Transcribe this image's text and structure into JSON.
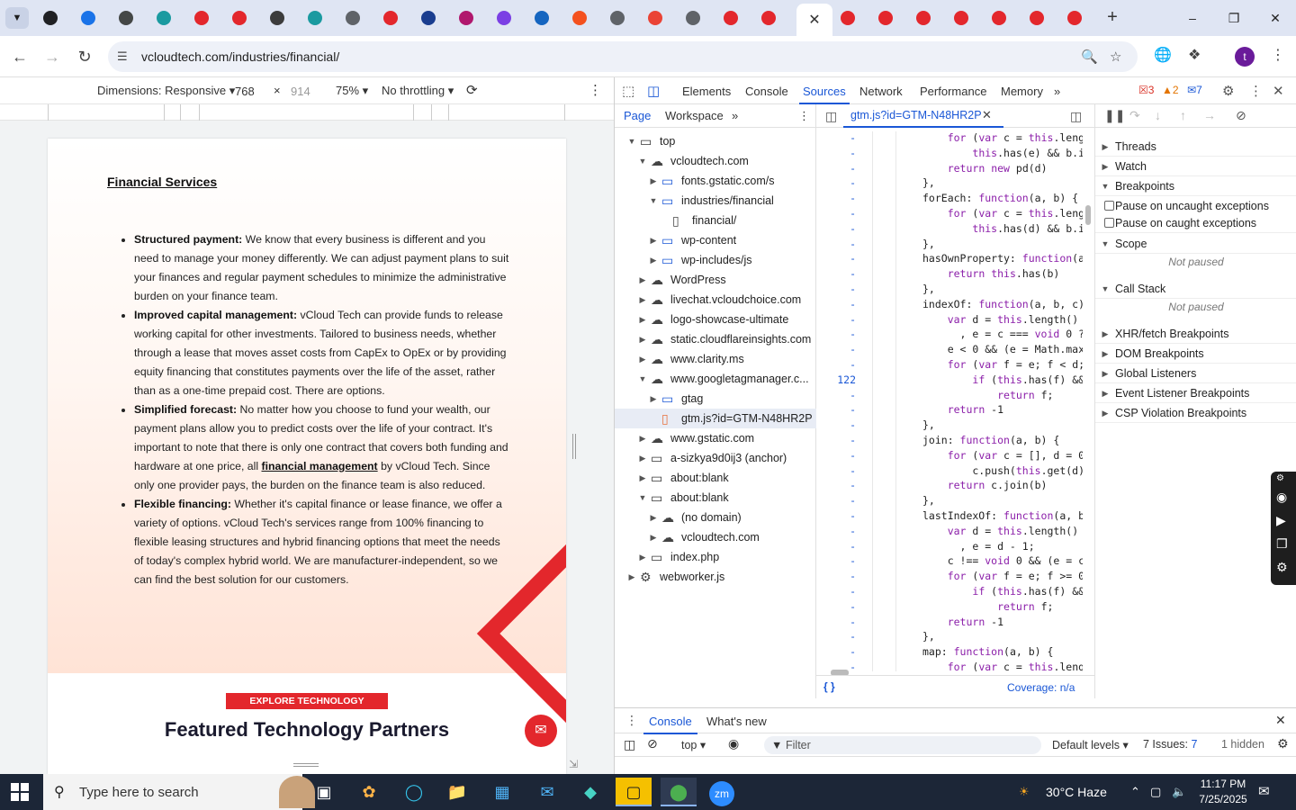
{
  "browser": {
    "tab_search_icon": "chevron-down",
    "tabs": [
      {
        "name": "tab-1",
        "color": "#202124"
      },
      {
        "name": "tab-2",
        "color": "#1a73e8"
      },
      {
        "name": "tab-3",
        "color": "#444746"
      },
      {
        "name": "tab-4",
        "color": "#1a9aa0"
      },
      {
        "name": "tab-5",
        "color": "#e3272c"
      },
      {
        "name": "tab-6",
        "color": "#e3272c"
      },
      {
        "name": "tab-7",
        "color": "#3c3c3c"
      },
      {
        "name": "tab-8",
        "color": "#1a9aa0"
      },
      {
        "name": "tab-9",
        "color": "#5f6368"
      },
      {
        "name": "tab-10",
        "color": "#e3272c"
      },
      {
        "name": "tab-11",
        "color": "#1a3d8f"
      },
      {
        "name": "tab-12",
        "color": "#b0176d"
      },
      {
        "name": "tab-13",
        "color": "#7b3fe4"
      },
      {
        "name": "tab-14",
        "color": "#1565c0"
      },
      {
        "name": "tab-15",
        "color": "#f4511e"
      },
      {
        "name": "tab-16",
        "color": "#5f6368"
      },
      {
        "name": "tab-17",
        "color": "#ea4335"
      },
      {
        "name": "tab-18",
        "color": "#5f6368"
      },
      {
        "name": "tab-19",
        "color": "#e3272c"
      },
      {
        "name": "tab-20",
        "color": "#e3272c"
      }
    ],
    "active_tab_close": "✕",
    "tabs_after": [
      {
        "name": "tab-22",
        "color": "#e3272c"
      },
      {
        "name": "tab-23",
        "color": "#e3272c"
      },
      {
        "name": "tab-24",
        "color": "#e3272c"
      },
      {
        "name": "tab-25",
        "color": "#e3272c"
      },
      {
        "name": "tab-26",
        "color": "#e3272c"
      },
      {
        "name": "tab-27",
        "color": "#e3272c"
      },
      {
        "name": "tab-28",
        "color": "#e3272c"
      }
    ],
    "new_tab": "+",
    "url": "vcloudtech.com/industries/financial/",
    "profile_initial": "t"
  },
  "device_toolbar": {
    "dimensions_label": "Dimensions: Responsive",
    "width": "768",
    "times": "×",
    "height_placeholder": "914",
    "zoom": "75%",
    "throttling": "No throttling"
  },
  "site": {
    "title": "Financial Services",
    "bullets": [
      {
        "head": "Structured payment:",
        "text": " We know that every business is different and you need to manage your money differently. We can adjust payment plans to suit your finances and regular payment schedules to minimize the administrative burden on your finance team."
      },
      {
        "head": "Improved capital management:",
        "text": " vCloud Tech can provide funds to release working capital for other investments. Tailored to business needs, whether through a lease that moves asset costs from CapEx to OpEx or by providing equity financing that constitutes payments over the life of the asset, rather than as a one-time prepaid cost. There are options."
      },
      {
        "head": "Simplified forecast:",
        "text": " No matter how you choose to fund your wealth, our payment plans allow you to predict costs over the life of your contract. It's important to note that there is only one contract that covers both funding and hardware at one price, all ",
        "link": "financial management",
        "tail": " by vCloud Tech. Since only one provider pays, the burden on the finance team is also reduced."
      },
      {
        "head": "Flexible financing:",
        "text": " Whether it's capital finance or lease finance, we offer a variety of options. vCloud Tech's services range from 100% financing to flexible leasing structures and hybrid financing options that meet the needs of today's complex hybrid world. We are manufacturer-independent, so we can find the best solution for our customers."
      }
    ],
    "explore_button": "EXPLORE TECHNOLOGY PARTNERS",
    "featured_heading": "Featured Technology Partners"
  },
  "devtools": {
    "tabs": [
      "Elements",
      "Console",
      "Sources",
      "Network",
      "Performance",
      "Memory"
    ],
    "active_tab": "Sources",
    "more_tabs": "»",
    "errors": "3",
    "warnings": "2",
    "messages": "7",
    "navigator_tabs": [
      "Page",
      "Workspace"
    ],
    "active_navigator_tab": "Page",
    "tree": [
      {
        "label": "top",
        "depth": 0,
        "icon": "frame",
        "open": true
      },
      {
        "label": "vcloudtech.com",
        "depth": 1,
        "icon": "cloud",
        "open": true
      },
      {
        "label": "fonts.gstatic.com/s",
        "depth": 2,
        "icon": "folder",
        "open": false
      },
      {
        "label": "industries/financial",
        "depth": 2,
        "icon": "folder",
        "open": true
      },
      {
        "label": "financial/",
        "depth": 3,
        "icon": "file",
        "open": null
      },
      {
        "label": "wp-content",
        "depth": 2,
        "icon": "folder",
        "open": false
      },
      {
        "label": "wp-includes/js",
        "depth": 2,
        "icon": "folder",
        "open": false
      },
      {
        "label": "WordPress",
        "depth": 1,
        "icon": "cloud",
        "open": false
      },
      {
        "label": "livechat.vcloudchoice.com",
        "depth": 1,
        "icon": "cloud",
        "open": false
      },
      {
        "label": "logo-showcase-ultimate",
        "depth": 1,
        "icon": "cloud",
        "open": false
      },
      {
        "label": "static.cloudflareinsights.com",
        "depth": 1,
        "icon": "cloud",
        "open": false
      },
      {
        "label": "www.clarity.ms",
        "depth": 1,
        "icon": "cloud",
        "open": false
      },
      {
        "label": "www.googletagmanager.c...",
        "depth": 1,
        "icon": "cloud",
        "open": true
      },
      {
        "label": "gtag",
        "depth": 2,
        "icon": "folder",
        "open": false
      },
      {
        "label": "gtm.js?id=GTM-N48HR2P",
        "depth": 2,
        "icon": "js-file",
        "open": null,
        "selected": true
      },
      {
        "label": "www.gstatic.com",
        "depth": 1,
        "icon": "cloud",
        "open": false
      },
      {
        "label": "a-sizkya9d0ij3 (anchor)",
        "depth": 1,
        "icon": "frame",
        "open": false
      },
      {
        "label": "about:blank",
        "depth": 1,
        "icon": "frame",
        "open": false
      },
      {
        "label": "about:blank",
        "depth": 1,
        "icon": "frame",
        "open": true
      },
      {
        "label": "(no domain)",
        "depth": 2,
        "icon": "cloud",
        "open": false
      },
      {
        "label": "vcloudtech.com",
        "depth": 2,
        "icon": "cloud",
        "open": false
      },
      {
        "label": "index.php",
        "depth": 1,
        "icon": "frame",
        "open": false
      },
      {
        "label": "webworker.js",
        "depth": 0,
        "icon": "gear",
        "open": false
      }
    ],
    "open_file": "gtm.js?id=GTM-N48HR2P",
    "code_lines": [
      {
        "n": "-",
        "code": "    for (var c = this.lengt"
      },
      {
        "n": "-",
        "code": "        this.has(e) && b.ir"
      },
      {
        "n": "-",
        "code": "    return new pd(d)"
      },
      {
        "n": "-",
        "code": "},"
      },
      {
        "n": "-",
        "code": "forEach: function(a, b) {"
      },
      {
        "n": "-",
        "code": "    for (var c = this.lengt"
      },
      {
        "n": "-",
        "code": "        this.has(d) && b.ir"
      },
      {
        "n": "-",
        "code": "},"
      },
      {
        "n": "-",
        "code": "hasOwnProperty: function(a,"
      },
      {
        "n": "-",
        "code": "    return this.has(b)"
      },
      {
        "n": "-",
        "code": "},"
      },
      {
        "n": "-",
        "code": "indexOf: function(a, b, c)"
      },
      {
        "n": "-",
        "code": "    var d = this.length()"
      },
      {
        "n": "-",
        "code": "      , e = c === void 0 ?"
      },
      {
        "n": "-",
        "code": "    e < 0 && (e = Math.max("
      },
      {
        "n": "-",
        "code": "    for (var f = e; f < d;"
      },
      {
        "n": "122",
        "code": "        if (this.has(f) &&"
      },
      {
        "n": "-",
        "code": "            return f;"
      },
      {
        "n": "-",
        "code": "    return -1"
      },
      {
        "n": "-",
        "code": "},"
      },
      {
        "n": "-",
        "code": "join: function(a, b) {"
      },
      {
        "n": "-",
        "code": "    for (var c = [], d = 0;"
      },
      {
        "n": "-",
        "code": "        c.push(this.get(d))"
      },
      {
        "n": "-",
        "code": "    return c.join(b)"
      },
      {
        "n": "-",
        "code": "},"
      },
      {
        "n": "-",
        "code": "lastIndexOf: function(a, b,"
      },
      {
        "n": "-",
        "code": "    var d = this.length()"
      },
      {
        "n": "-",
        "code": "      , e = d - 1;"
      },
      {
        "n": "-",
        "code": "    c !== void 0 && (e = c"
      },
      {
        "n": "-",
        "code": "    for (var f = e; f >= 0;"
      },
      {
        "n": "-",
        "code": "        if (this.has(f) &&"
      },
      {
        "n": "-",
        "code": "            return f;"
      },
      {
        "n": "-",
        "code": "    return -1"
      },
      {
        "n": "-",
        "code": "},"
      },
      {
        "n": "-",
        "code": "map: function(a, b) {"
      },
      {
        "n": "-",
        "code": "    for (var c = this.lengt"
      }
    ],
    "format_icon": "{ }",
    "coverage": "Coverage: n/a",
    "debug_sections": [
      {
        "label": "Threads",
        "open": false
      },
      {
        "label": "Watch",
        "open": false
      },
      {
        "label": "Breakpoints",
        "open": true
      }
    ],
    "pause_uncaught": "Pause on uncaught exceptions",
    "pause_caught": "Pause on caught exceptions",
    "scope": "Scope",
    "not_paused": "Not paused",
    "call_stack": "Call Stack",
    "more_breakpoints": [
      "XHR/fetch Breakpoints",
      "DOM Breakpoints",
      "Global Listeners",
      "Event Listener Breakpoints",
      "CSP Violation Breakpoints"
    ],
    "drawer_tabs": [
      "Console",
      "What's new"
    ],
    "active_drawer_tab": "Console",
    "context": "top",
    "filter_placeholder": "Filter",
    "levels": "Default levels",
    "issues": "7 Issues:",
    "issues_count": "7",
    "hidden": "1 hidden"
  },
  "taskbar": {
    "search_placeholder": "Type here to search",
    "apps": [
      "task-view",
      "copilot",
      "edge",
      "file-explorer",
      "store",
      "mail",
      "app-teal",
      "sticky-notes",
      "chrome",
      "zoom"
    ],
    "weather": "30°C  Haze",
    "time": "11:17 PM",
    "date": "7/25/2025"
  }
}
